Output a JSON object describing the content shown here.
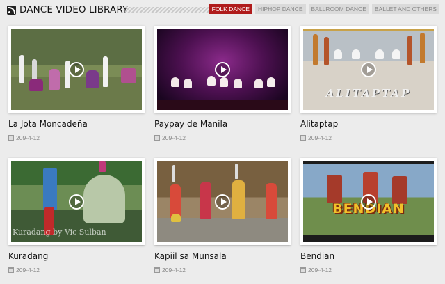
{
  "header": {
    "title": "DANCE VIDEO LIBRARY",
    "tabs": [
      {
        "label": "FOLK DANCE",
        "active": true
      },
      {
        "label": "HIPHOP DANCE",
        "active": false
      },
      {
        "label": "BALLROOM DANCE",
        "active": false
      },
      {
        "label": "BALLET AND OTHERS",
        "active": false
      }
    ]
  },
  "colors": {
    "accent": "#b01c1c",
    "background": "#ececec",
    "tab_inactive": "#dadada"
  },
  "videos": [
    {
      "title": "La Jota Moncadeña",
      "date": "209-4-12"
    },
    {
      "title": "Paypay de Manila",
      "date": "209-4-12"
    },
    {
      "title": "Alitaptap",
      "date": "209-4-12",
      "thumb_caption": "ALITAPTAP"
    },
    {
      "title": "Kuradang",
      "date": "209-4-12",
      "thumb_caption": "Kuradang by Vic Sulban"
    },
    {
      "title": "Kapiil sa Munsala",
      "date": "209-4-12"
    },
    {
      "title": "Bendian",
      "date": "209-4-12",
      "thumb_caption": "BENDIAN"
    }
  ],
  "icons": {
    "feed": "rss-icon",
    "play": "play-icon",
    "date": "calendar-icon"
  }
}
